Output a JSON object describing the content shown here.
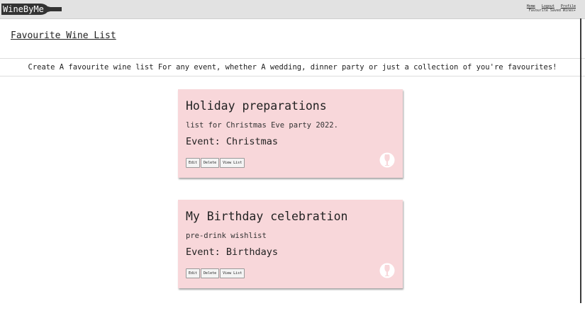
{
  "app": {
    "logo_text": "WineByMe"
  },
  "nav": {
    "links": [
      "Home",
      "Logout",
      "Profile"
    ],
    "dropdown_label": "Favourite Saved Wines"
  },
  "page": {
    "title": "Favourite Wine List",
    "intro": "Create A favourite wine list For any event, whether A wedding, dinner party or just a collection of you're favourites!"
  },
  "cards": [
    {
      "title": "Holiday preparations",
      "description": "list for Christmas Eve party 2022.",
      "event": "Event: Christmas",
      "buttons": {
        "edit": "Edit",
        "delete": "Delete",
        "view": "View List"
      },
      "icon": "wine-glass-icon"
    },
    {
      "title": "My Birthday celebration",
      "description": "pre-drink wishlist",
      "event": "Event: Birthdays",
      "buttons": {
        "edit": "Edit",
        "delete": "Delete",
        "view": "View List"
      },
      "icon": "wine-glass-icon"
    }
  ],
  "colors": {
    "card_bg": "#f8d7da",
    "topbar_bg": "#e2e2e2",
    "logo_bg": "#333333"
  }
}
